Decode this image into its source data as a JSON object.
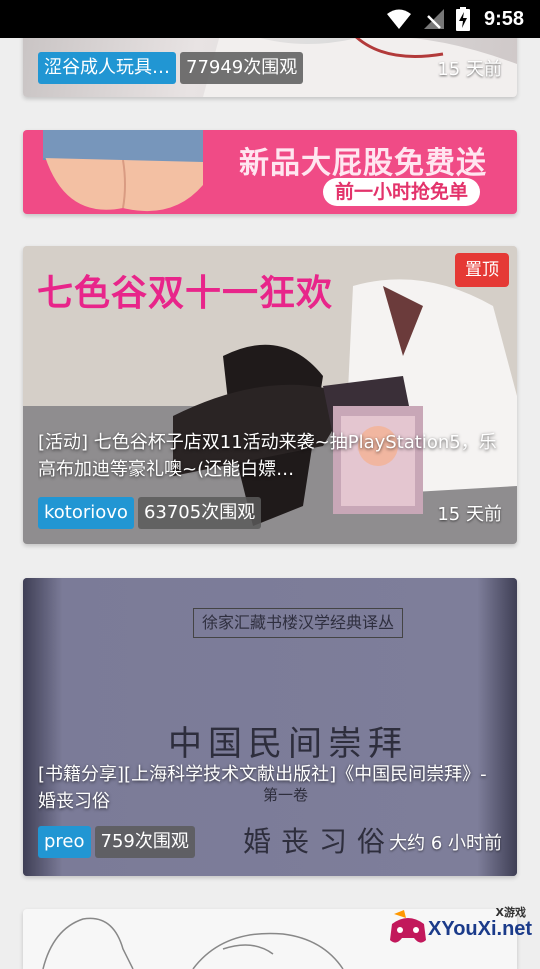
{
  "status_bar": {
    "time": "9:58"
  },
  "colors": {
    "author_tag": "#2196d3",
    "pinned": "#e53935",
    "banner_bg": "#f04b86",
    "banner_text": "#ffe6f0"
  },
  "cards": [
    {
      "author": "涩谷成人玩具…",
      "views": "77949次围观",
      "time": "15 天前"
    },
    {
      "banner_title": "新品大屁股免费送",
      "banner_subtitle": "前一小时抢免单"
    },
    {
      "overlay_title": "七色谷双十一狂欢",
      "pinned": "置顶",
      "caption": "[活动] 七色谷杯子店双11活动来袭~抽PlayStation5，乐高布加迪等豪礼噢~(还能白嫖…",
      "author": "kotoriovo",
      "views": "63705次围观",
      "time": "15 天前"
    },
    {
      "book_series": "徐家汇藏书楼汉学经典译丛",
      "book_title": "中国民间崇拜",
      "book_volume": "第一卷",
      "book_subtitle": "婚丧习俗",
      "caption": "[书籍分享][上海科学技术文献出版社]《中国民间崇拜》- 婚丧习俗",
      "author": "preo",
      "views": "759次围观",
      "time": "大约 6 小时前"
    }
  ],
  "watermark": {
    "brand": "XYouXi.net",
    "small": "X游戏"
  }
}
